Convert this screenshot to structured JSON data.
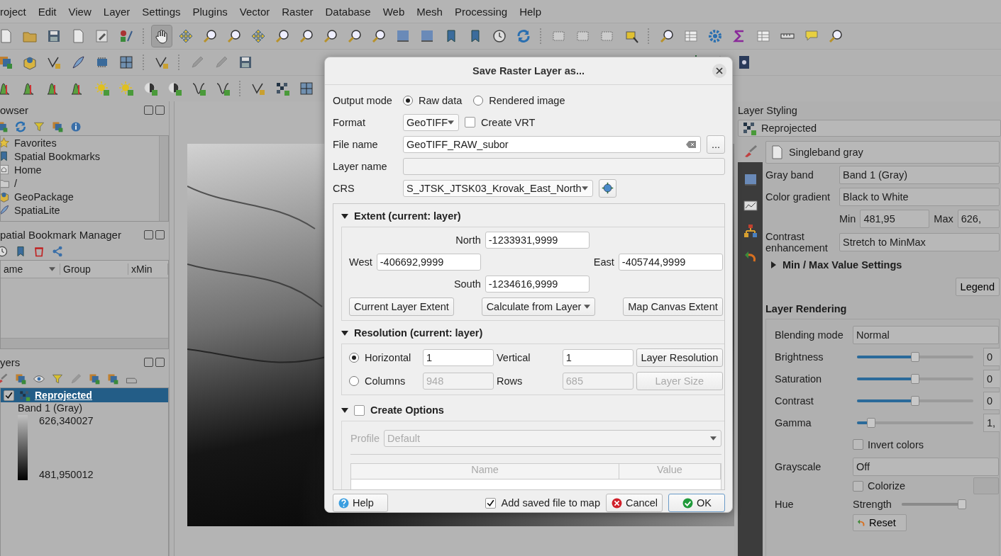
{
  "menu": [
    "roject",
    "Edit",
    "View",
    "Layer",
    "Settings",
    "Plugins",
    "Vector",
    "Raster",
    "Database",
    "Web",
    "Mesh",
    "Processing",
    "Help"
  ],
  "browser": {
    "title": "owser",
    "items": [
      "Favorites",
      "Spatial Bookmarks",
      "Home",
      "/",
      "GeoPackage",
      "SpatiaLite"
    ]
  },
  "bookmarks": {
    "title": "patial Bookmark Manager",
    "columns": [
      "ame",
      "Group",
      "xMin"
    ]
  },
  "layers": {
    "title": "yers",
    "items": [
      {
        "name": "Reprojected",
        "checked": true,
        "selected": true
      }
    ],
    "legend": {
      "band": "Band 1 (Gray)",
      "max": "626,340027",
      "min": "481,950012"
    }
  },
  "styling": {
    "title": "Layer Styling",
    "layer": "Reprojected",
    "renderer": "Singleband gray",
    "fields": [
      {
        "label": "Gray band",
        "value": "Band 1 (Gray)"
      },
      {
        "label": "Color gradient",
        "value": "Black to White"
      }
    ],
    "min_label": "Min",
    "min": "481,95",
    "max_label": "Max",
    "max": "626,",
    "contrast_label": "Contrast enhancement",
    "contrast": "Stretch to MinMax",
    "minmax_section": {
      "title": "Min / Max Value Settings",
      "expanded": false
    },
    "legend_button": "Legend",
    "rendering_title": "Layer Rendering",
    "rows": [
      {
        "kind": "select",
        "label": "Blending mode",
        "value": "Normal"
      },
      {
        "kind": "slider",
        "label": "Brightness",
        "level": 0.5,
        "value": "0"
      },
      {
        "kind": "slider",
        "label": "Saturation",
        "level": 0.5,
        "value": "0"
      },
      {
        "kind": "slider",
        "label": "Contrast",
        "level": 0.5,
        "value": "0"
      },
      {
        "kind": "slider",
        "label": "Gamma",
        "level": 0.12,
        "value": "1,"
      },
      {
        "kind": "check",
        "label": "Invert colors",
        "checked": false
      },
      {
        "kind": "select",
        "label": "Grayscale",
        "value": "Off"
      }
    ],
    "hue": {
      "label": "Hue",
      "colorize": "Colorize",
      "colorize_checked": false,
      "strength": "Strength",
      "level": 0.97,
      "reset": "Reset"
    }
  },
  "dialog": {
    "title": "Save Raster Layer as...",
    "output_mode": {
      "label": "Output mode",
      "options": [
        {
          "label": "Raw data",
          "selected": true
        },
        {
          "label": "Rendered image",
          "selected": false
        }
      ]
    },
    "format": {
      "label": "Format",
      "value": "GeoTIFF"
    },
    "create_vrt": {
      "label": "Create VRT",
      "checked": false
    },
    "file_name": {
      "label": "File name",
      "value": "GeoTIFF_RAW_subor",
      "browse": "..."
    },
    "layer_name": {
      "label": "Layer name"
    },
    "crs": {
      "label": "CRS",
      "value": "S_JTSK_JTSK03_Krovak_East_North"
    },
    "extent": {
      "title": "Extent (current: layer)",
      "expanded": true,
      "north_label": "North",
      "north": "-1233931,9999",
      "west_label": "West",
      "west": "-406692,9999",
      "east_label": "East",
      "east": "-405744,9999",
      "south_label": "South",
      "south": "-1234616,9999",
      "buttons": [
        "Current Layer Extent",
        "Calculate from Layer",
        "Map Canvas Extent"
      ]
    },
    "resolution": {
      "title": "Resolution (current: layer)",
      "expanded": true,
      "horizontal": {
        "label": "Horizontal",
        "selected": true,
        "value": "1",
        "second_label": "Vertical",
        "second_value": "1",
        "button": "Layer Resolution"
      },
      "columns": {
        "label": "Columns",
        "selected": false,
        "value": "948",
        "second_label": "Rows",
        "second_value": "685",
        "button": "Layer Size"
      }
    },
    "create_options": {
      "title": "Create Options",
      "expanded": true,
      "checked": false,
      "profile_label": "Profile",
      "profile": "Default",
      "table_columns": [
        "Name",
        "Value"
      ]
    },
    "help": "Help",
    "add_to_map": {
      "label": "Add saved file to map",
      "checked": true
    },
    "cancel": "Cancel",
    "ok": "OK"
  }
}
